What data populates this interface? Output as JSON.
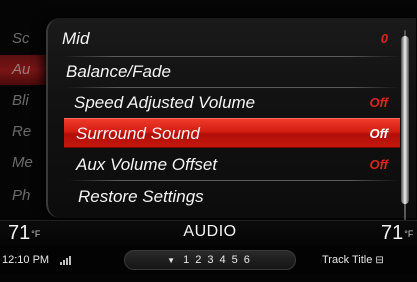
{
  "side_tabs": [
    {
      "label": "Sc",
      "active": false
    },
    {
      "label": "Au",
      "active": true
    },
    {
      "label": "Bli",
      "active": false
    },
    {
      "label": "Re",
      "active": false
    },
    {
      "label": "Me",
      "active": false
    },
    {
      "label": "Ph",
      "active": false
    }
  ],
  "menu": {
    "items": [
      {
        "label": "Mid",
        "value": "0",
        "selected": false
      },
      {
        "label": "Balance/Fade",
        "value": "",
        "selected": false
      },
      {
        "label": "Speed Adjusted Volume",
        "value": "Off",
        "selected": false
      },
      {
        "label": "Surround Sound",
        "value": "Off",
        "selected": true
      },
      {
        "label": "Aux Volume Offset",
        "value": "Off",
        "selected": false
      },
      {
        "label": "Restore Settings",
        "value": "",
        "selected": false
      }
    ]
  },
  "status": {
    "temp_left": "71",
    "temp_right": "71",
    "temp_unit": "°F",
    "mode": "AUDIO",
    "clock": "12:10 PM",
    "preset_arrow": "▼",
    "presets": [
      "1",
      "2",
      "3",
      "4",
      "5",
      "6"
    ],
    "track_title": "Track Title"
  },
  "icons": {
    "signal": "signal-strength-icon",
    "track": "media-info-icon",
    "preset_arrow": "chevron-down-icon"
  },
  "colors": {
    "accent_red": "#d31d12",
    "value_red": "#d8261f",
    "text": "#f4f4f4",
    "background": "#050505"
  }
}
